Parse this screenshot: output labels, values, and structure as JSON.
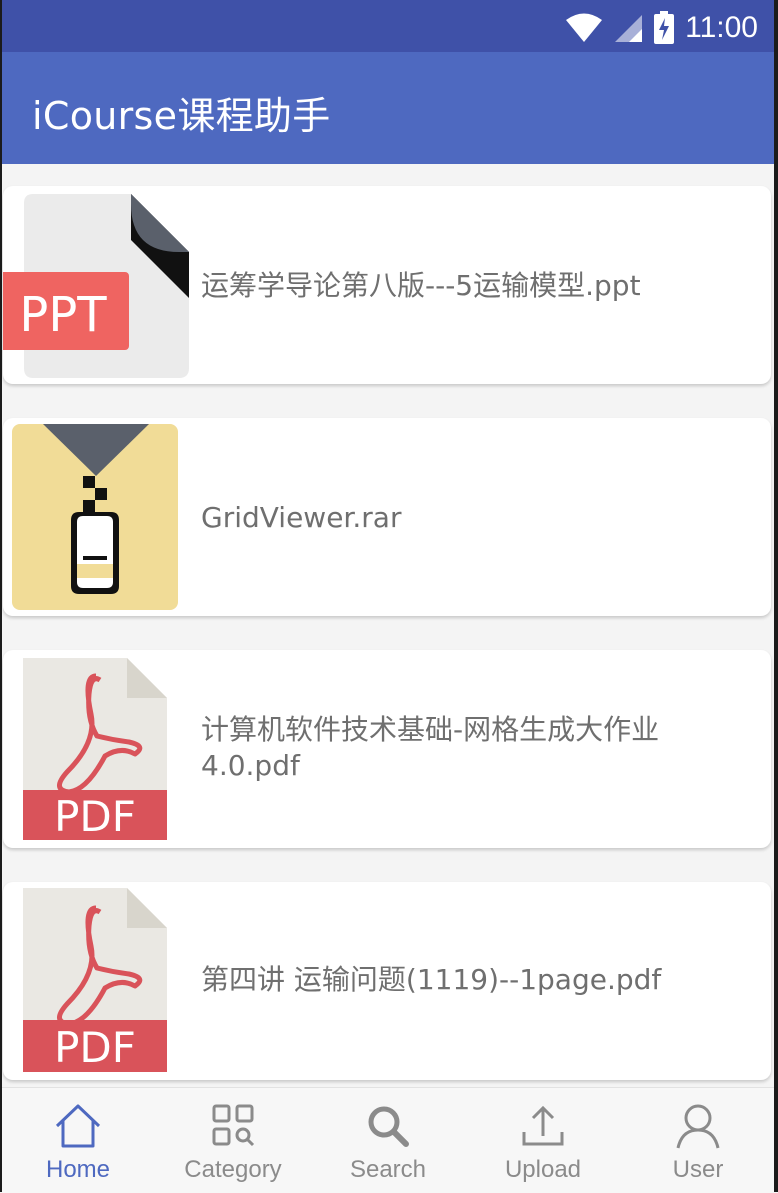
{
  "status_bar": {
    "time": "11:00",
    "icons": [
      "wifi-icon",
      "cell-signal-icon",
      "battery-charging-icon"
    ]
  },
  "app_bar": {
    "title": "iCourse课程助手"
  },
  "files": [
    {
      "name": "运筹学导论第八版---5运输模型.ppt",
      "type_badge": "PPT",
      "icon": "ppt-file-icon"
    },
    {
      "name": "GridViewer.rar",
      "type_badge": "",
      "icon": "zip-archive-icon"
    },
    {
      "name": "计算机软件技术基础-网格生成大作业4.0.pdf",
      "type_badge": "PDF",
      "icon": "pdf-file-icon"
    },
    {
      "name": "第四讲 运输问题(1119)--1page.pdf",
      "type_badge": "PDF",
      "icon": "pdf-file-icon"
    }
  ],
  "bottom_nav": {
    "items": [
      {
        "label": "Home",
        "icon": "home-icon",
        "active": true
      },
      {
        "label": "Category",
        "icon": "category-icon",
        "active": false
      },
      {
        "label": "Search",
        "icon": "search-icon",
        "active": false
      },
      {
        "label": "Upload",
        "icon": "upload-icon",
        "active": false
      },
      {
        "label": "User",
        "icon": "user-icon",
        "active": false
      }
    ]
  },
  "colors": {
    "status_bar": "#3f51a8",
    "app_bar": "#4e69c0",
    "accent": "#4e69c0",
    "ppt_badge": "#ef6461",
    "pdf_badge": "#d9535a",
    "zip_background": "#f1dc97"
  }
}
